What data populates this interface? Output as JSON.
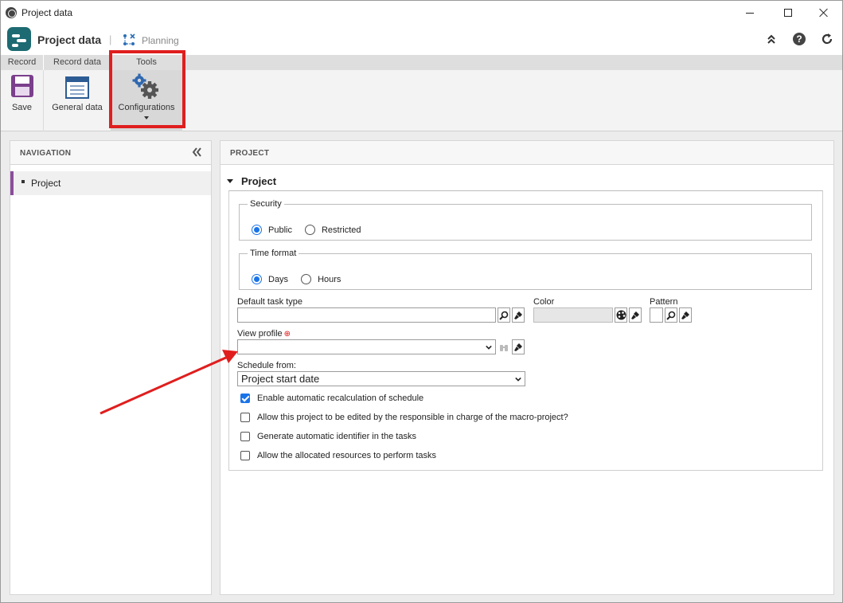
{
  "window": {
    "title": "Project data"
  },
  "header": {
    "title": "Project data",
    "separator": "|",
    "breadcrumb": "Planning"
  },
  "ribbon": {
    "tabs": [
      {
        "label": "Record"
      },
      {
        "label": "Record data"
      },
      {
        "label": "Tools"
      }
    ],
    "buttons": {
      "save": "Save",
      "general_data": "General data",
      "configurations": "Configurations"
    },
    "highlight_color": "#e01e1e"
  },
  "navigation": {
    "title": "NAVIGATION",
    "items": [
      {
        "label": "Project"
      }
    ]
  },
  "project": {
    "panel_title": "PROJECT",
    "section_title": "Project",
    "security": {
      "legend": "Security",
      "options": [
        {
          "label": "Public",
          "selected": true
        },
        {
          "label": "Restricted",
          "selected": false
        }
      ]
    },
    "time_format": {
      "legend": "Time format",
      "options": [
        {
          "label": "Days",
          "selected": true
        },
        {
          "label": "Hours",
          "selected": false
        }
      ]
    },
    "fields": {
      "default_task_type": {
        "label": "Default task type",
        "value": ""
      },
      "color": {
        "label": "Color",
        "value": ""
      },
      "pattern": {
        "label": "Pattern",
        "value": ""
      },
      "view_profile": {
        "label": "View profile",
        "required_mark": "⊕",
        "value": ""
      },
      "schedule_from": {
        "label": "Schedule from:",
        "value": "Project start date"
      }
    },
    "checkboxes": [
      {
        "label": "Enable automatic recalculation of schedule",
        "checked": true
      },
      {
        "label": "Allow this project to be edited by the responsible in charge of the macro-project?",
        "checked": false
      },
      {
        "label": "Generate automatic identifier in the tasks",
        "checked": false
      },
      {
        "label": "Allow the allocated resources to perform tasks",
        "checked": false
      }
    ]
  },
  "colors": {
    "accent": "#8a4e9b",
    "brand": "#1d6a72",
    "selection": "#1a73e8"
  }
}
